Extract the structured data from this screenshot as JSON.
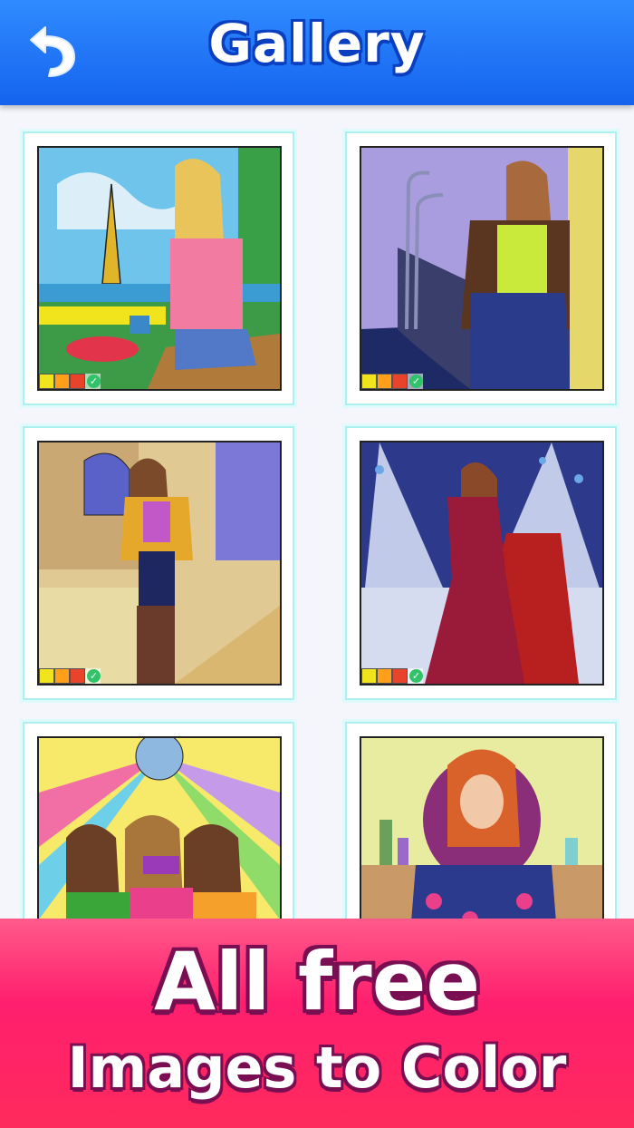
{
  "header": {
    "title": "Gallery",
    "back_icon": "back-arrow-icon",
    "color_top": "#2f8bff",
    "color_bottom": "#1563ee"
  },
  "gallery": {
    "items": [
      {
        "name": "paris-eiffel-tower-girl",
        "status": "completed",
        "palette": [
          "#f2e41c",
          "#ff9f1a",
          "#e8432b"
        ]
      },
      {
        "name": "street-lamp-jacket-girl",
        "status": "completed",
        "palette": [
          "#f2e41c",
          "#ff9f1a",
          "#e8432b"
        ]
      },
      {
        "name": "city-street-yellow-coat-girl",
        "status": "completed",
        "palette": [
          "#f2e41c",
          "#ff9f1a",
          "#e8432b"
        ]
      },
      {
        "name": "red-carpet-gown-woman",
        "status": "completed",
        "palette": [
          "#f2e41c",
          "#ff9f1a",
          "#e8432b"
        ]
      },
      {
        "name": "disco-friends-selfie",
        "status": "in-progress"
      },
      {
        "name": "vanity-floral-top-woman",
        "status": "in-progress"
      }
    ],
    "check_icon": "check-icon"
  },
  "banner": {
    "line1": "All free",
    "line2": "Images to Color",
    "color": "#ff2a6c"
  }
}
